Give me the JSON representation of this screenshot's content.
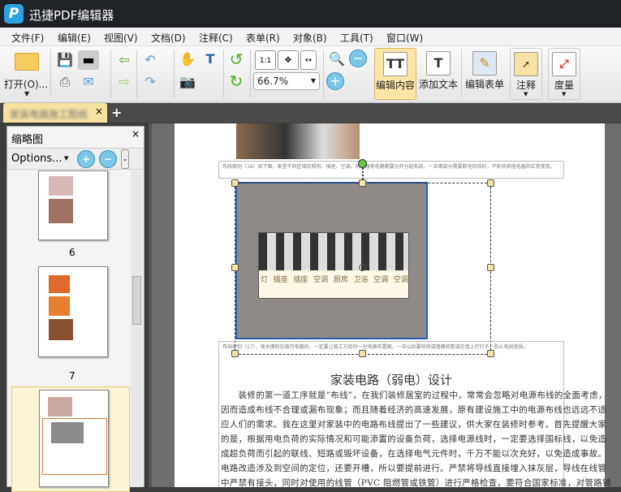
{
  "app": {
    "title": "迅捷PDF编辑器",
    "logo": "P"
  },
  "menu": [
    "文件(F)",
    "编辑(E)",
    "视图(V)",
    "文档(D)",
    "注释(C)",
    "表单(R)",
    "对象(B)",
    "工具(T)",
    "窗口(W)"
  ],
  "toolbar": {
    "open": "打开(O)...",
    "zoom": "66.7%",
    "edit_content": "编辑内容",
    "add_text": "添加文本",
    "edit_form": "编辑表单",
    "annotate": "注释",
    "measure": "度量",
    "actual_size": "1:1"
  },
  "tab": {
    "label": "家装电路施工图纸",
    "close": "×",
    "add": "+"
  },
  "panel": {
    "title": "缩略图",
    "close": "×",
    "options": "Options...",
    "pages": [
      "6",
      "7"
    ]
  },
  "doc": {
    "caption1": "布线原则（16）如下图，家里不同区域的照明、插座、空调、热水器等电路都要分开分组布线，一旦哪部分需要断电检修时，不影响其他电器的正常使用。",
    "caption2": "布线原则（17），很关键的在做完电路后，一定要让施工方给你一份电路布置图，一旦以后要检修或墙面修整或在墙上打钉子，防止电线受损。",
    "heading": "家装电路（弱电）设计",
    "body": [
      "　　装修的第一道工序就是”布线”，在我们装修居室的过程中，常常会忽略对电源布线的全面考虑，",
      "因而造成布线不合理或漏布现象；而且随着经济的高速发展，原有建设施工中的电源布线也远远不适",
      "应人们的需求。我在这里对家装中的电路布线提出了一些建议，供大家在装修时参考。首先提醒大家",
      "的是，根据用电负荷的实际情况和可能添置的设备负荷，选择电源线时，一定要选择国标线，以免造",
      "成超负荷而引起的联线、短路或毁坏设备，在选择电气元件时，千万不能以次充好，以免造成事故。",
      "电路改造涉及到空间的定位，还要开槽，所以要提前进行。严禁将导线直接埋入抹灰层，导线在线管",
      "中严禁有接头，同时对使用的线管（PVC 阻燃管或铁管）进行严格检查，要符合国家标准，对管路铺"
    ],
    "breaker_labels": [
      "灯",
      "插座",
      "插座",
      "空调",
      "厨房",
      "卫浴",
      "空调",
      "空调"
    ]
  },
  "colors": {
    "accent": "#f7e2a5",
    "title_bg": "#1f2226",
    "selection": "#2a5fb0"
  }
}
